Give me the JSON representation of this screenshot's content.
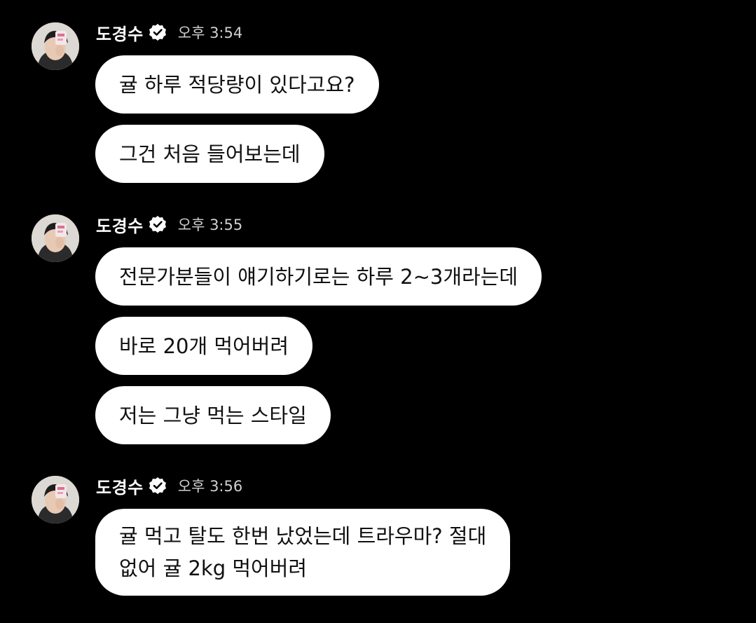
{
  "colors": {
    "background": "#000000",
    "bubble": "#ffffff",
    "bubble_text": "#111111",
    "sender_text": "#ffffff",
    "time_text": "#d0d0d0"
  },
  "groups": [
    {
      "sender": "도경수",
      "verified_icon": "verified-badge-icon",
      "time": "오후 3:54",
      "messages": [
        {
          "lines": [
            "귤 하루 적당량이 있다고요?"
          ]
        },
        {
          "lines": [
            "그건 처음 들어보는데"
          ]
        }
      ]
    },
    {
      "sender": "도경수",
      "verified_icon": "verified-badge-icon",
      "time": "오후 3:55",
      "messages": [
        {
          "lines": [
            "전문가분들이 얘기하기로는 하루 2~3개라는데"
          ]
        },
        {
          "lines": [
            "바로 20개 먹어버려"
          ]
        },
        {
          "lines": [
            "저는 그냥 먹는 스타일"
          ]
        }
      ]
    },
    {
      "sender": "도경수",
      "verified_icon": "verified-badge-icon",
      "time": "오후 3:56",
      "messages": [
        {
          "lines": [
            "귤 먹고 탈도 한번 났었는데 트라우마? 절대",
            "없어 귤 2kg 먹어버려"
          ]
        }
      ]
    }
  ]
}
